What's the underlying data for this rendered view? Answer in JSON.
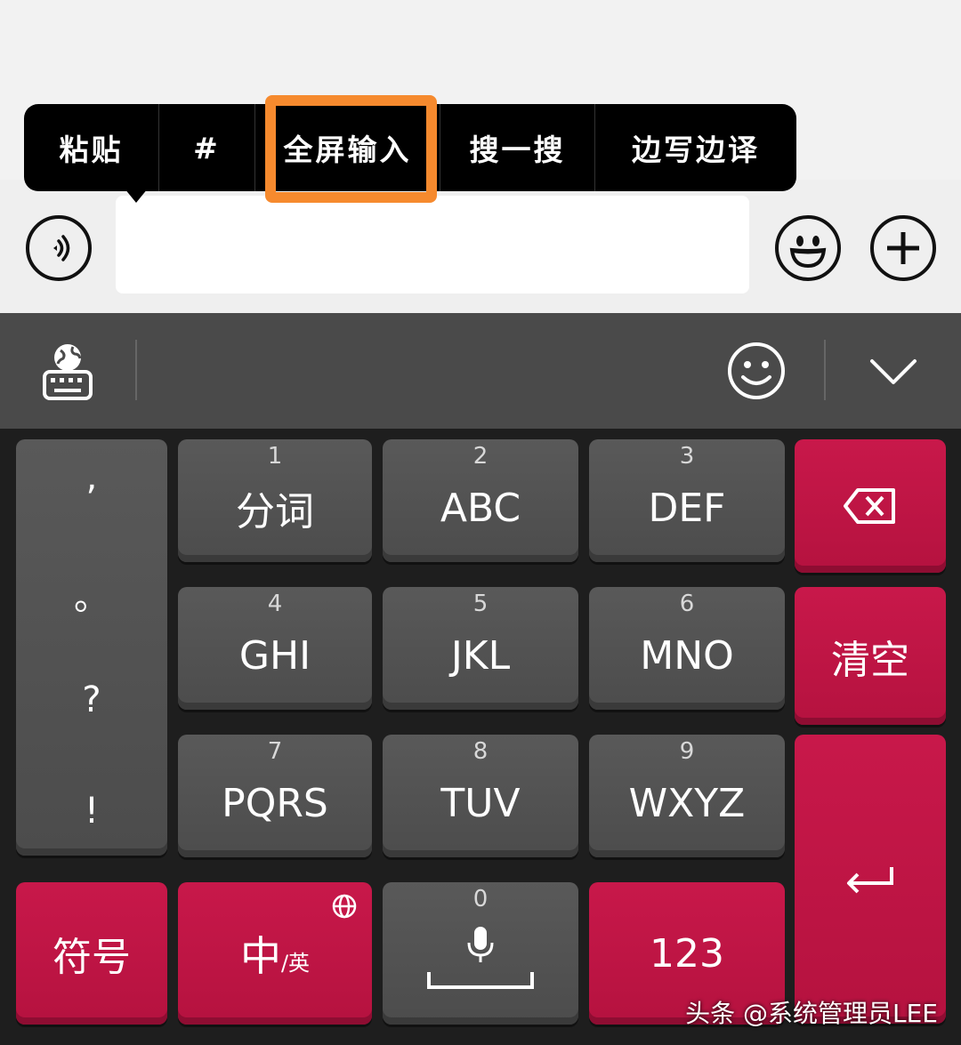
{
  "context_menu": {
    "items": [
      "粘贴",
      "#",
      "全屏输入",
      "搜一搜",
      "边写边译"
    ]
  },
  "keyboard": {
    "punctuation": [
      ",",
      "。",
      "?",
      "!"
    ],
    "keys": {
      "k1": {
        "num": "1",
        "label": "分词"
      },
      "k2": {
        "num": "2",
        "label": "ABC"
      },
      "k3": {
        "num": "3",
        "label": "DEF"
      },
      "k4": {
        "num": "4",
        "label": "GHI"
      },
      "k5": {
        "num": "5",
        "label": "JKL"
      },
      "k6": {
        "num": "6",
        "label": "MNO"
      },
      "k7": {
        "num": "7",
        "label": "PQRS"
      },
      "k8": {
        "num": "8",
        "label": "TUV"
      },
      "k9": {
        "num": "9",
        "label": "WXYZ"
      },
      "k0": {
        "num": "0"
      }
    },
    "clear": "清空",
    "symbol": "符号",
    "lang_main": "中",
    "lang_sub": "/英",
    "num123": "123"
  },
  "watermark": "头条 @系统管理员LEE",
  "colors": {
    "accent_red": "#c8184a",
    "key_gray": "#555555",
    "highlight_orange": "#f68a2e"
  },
  "icons": [
    "voice-icon",
    "emoji-icon",
    "plus-icon",
    "keyboard-globe-icon",
    "smiley-icon",
    "chevron-down-icon",
    "backspace-icon",
    "globe-icon",
    "mic-icon",
    "space-bar-icon",
    "enter-icon"
  ]
}
